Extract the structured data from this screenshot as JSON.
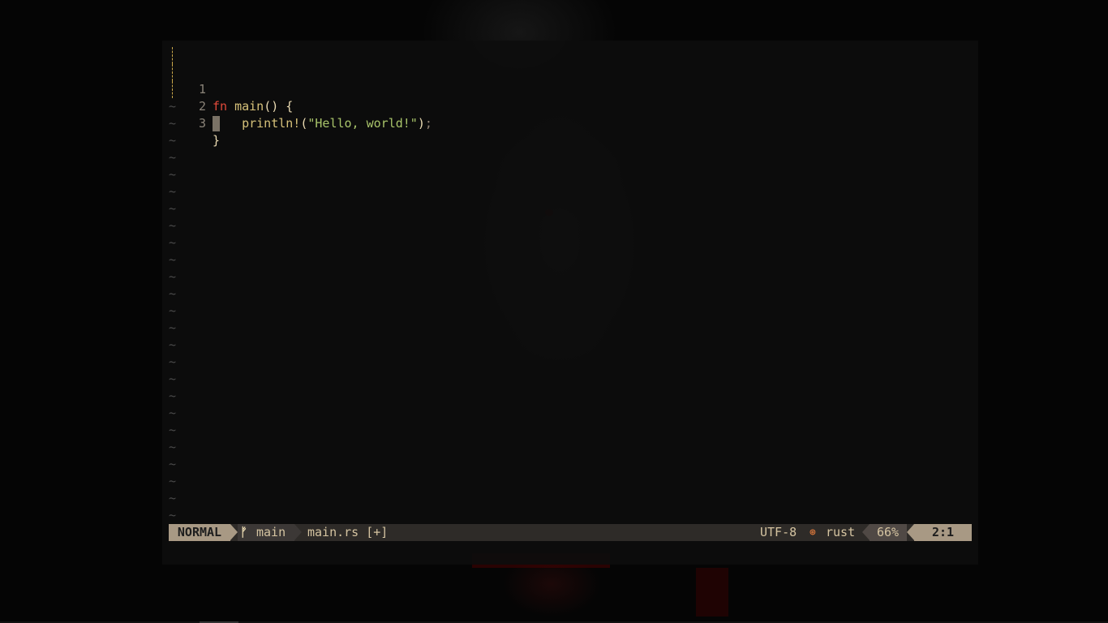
{
  "editor": {
    "lines": [
      {
        "number": "1",
        "tokens": [
          {
            "text": "fn",
            "kind": "kw"
          },
          {
            "text": " ",
            "kind": "punc"
          },
          {
            "text": "main",
            "kind": "fn"
          },
          {
            "text": "() {",
            "kind": "punc"
          }
        ]
      },
      {
        "number": "2",
        "tokens": [
          {
            "text": "   ",
            "kind": "punc"
          },
          {
            "text": "println!",
            "kind": "fn"
          },
          {
            "text": "(",
            "kind": "punc"
          },
          {
            "text": "\"Hello, world!\"",
            "kind": "str"
          },
          {
            "text": ")",
            "kind": "punc"
          },
          {
            "text": ";",
            "kind": "semi"
          }
        ]
      },
      {
        "number": "3",
        "tokens": [
          {
            "text": "}",
            "kind": "punc"
          }
        ]
      }
    ],
    "tilde": "~",
    "colors": {
      "keyword": "#e24a3b",
      "function": "#d7c27a",
      "string": "#a9c46a",
      "punctuation": "#ebdbb2",
      "line_number": "#8a8378",
      "tilde": "#4a4a4a",
      "indent_guide": "#c8a64a"
    }
  },
  "statusline": {
    "mode": "NORMAL",
    "branch_icon": "git-branch-icon",
    "branch_glyph": "ᚠ",
    "branch": "main",
    "file": "main.rs [+]",
    "encoding": "UTF-8",
    "filetype_icon": "rust-icon",
    "filetype_glyph": "⊛",
    "filetype": "rust",
    "percent": "66%",
    "position": "2:1",
    "colors": {
      "mode_bg": "#a89984",
      "bar_bg": "#2e2b28",
      "pct_bg": "#504945"
    }
  }
}
